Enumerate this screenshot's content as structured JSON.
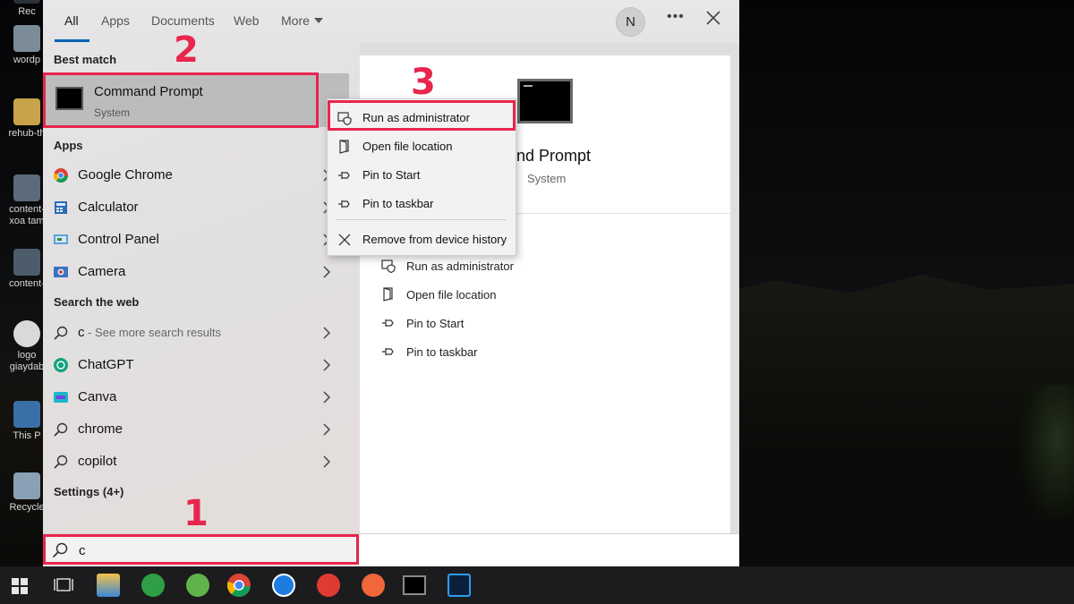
{
  "desktop": {
    "icons": [
      "Rec",
      "wordp",
      "rehub-th",
      "content-\nxoa tam",
      "content-",
      "logo\ngiaydab",
      "This P",
      "Recycle"
    ]
  },
  "tabs": {
    "items": [
      "All",
      "Apps",
      "Documents",
      "Web",
      "More"
    ],
    "active": "All",
    "avatar_initial": "N"
  },
  "best_match": {
    "heading": "Best match",
    "title": "Command Prompt",
    "subtitle": "System"
  },
  "apps": {
    "heading": "Apps",
    "items": [
      {
        "label": "Google Chrome",
        "icon": "chrome-icon"
      },
      {
        "label": "Calculator",
        "icon": "calculator-icon"
      },
      {
        "label": "Control Panel",
        "icon": "control-panel-icon"
      },
      {
        "label": "Camera",
        "icon": "camera-icon"
      }
    ]
  },
  "web": {
    "heading": "Search the web",
    "items": [
      {
        "label": "c",
        "suffix": " - See more search results",
        "icon": "search-icon"
      },
      {
        "label": "ChatGPT",
        "icon": "chatgpt-icon"
      },
      {
        "label": "Canva",
        "icon": "canva-icon"
      },
      {
        "label": "chrome",
        "icon": "search-icon"
      },
      {
        "label": "copilot",
        "icon": "search-icon"
      }
    ]
  },
  "settings": {
    "heading": "Settings (4+)"
  },
  "context_menu": {
    "items": [
      {
        "label": "Run as administrator",
        "icon": "shield-icon"
      },
      {
        "label": "Open file location",
        "icon": "file-location-icon"
      },
      {
        "label": "Pin to Start",
        "icon": "pin-icon"
      },
      {
        "label": "Pin to taskbar",
        "icon": "pin-icon"
      },
      {
        "label": "Remove from device history",
        "icon": "close-icon"
      }
    ]
  },
  "detail": {
    "title": "mand Prompt",
    "subtitle": "System",
    "actions": [
      {
        "label": "Run as administrator",
        "icon": "shield-icon"
      },
      {
        "label": "Open file location",
        "icon": "file-location-icon"
      },
      {
        "label": "Pin to Start",
        "icon": "pin-icon"
      },
      {
        "label": "Pin to taskbar",
        "icon": "pin-icon"
      }
    ]
  },
  "search": {
    "value": "c"
  },
  "annotations": {
    "step1": "1",
    "step2": "2",
    "step3": "3"
  },
  "colors": {
    "accent": "#0063b1",
    "annotation": "#e8254d",
    "selected_row": "#bcbcbd"
  }
}
